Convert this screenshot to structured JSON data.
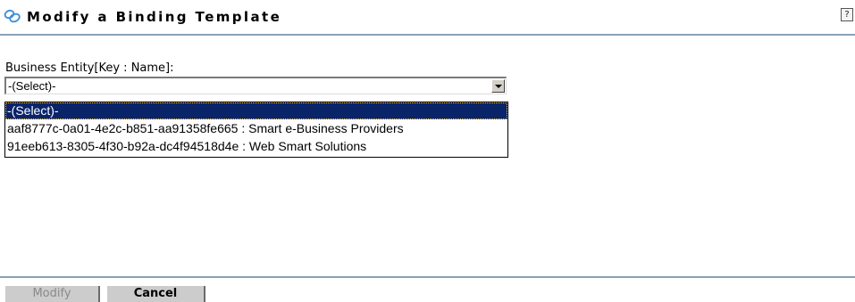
{
  "header": {
    "title": "Modify a Binding Template",
    "icon": "binding-template-icon",
    "help_icon_glyph": "?"
  },
  "form": {
    "business_entity": {
      "label": "Business Entity[Key : Name]:",
      "selected_value": "-(Select)-",
      "options": [
        {
          "label": "-(Select)-",
          "selected": true
        },
        {
          "label": "aaf8777c-0a01-4e2c-b851-aa91358fe665 : Smart e-Business Providers",
          "selected": false
        },
        {
          "label": "91eeb613-8305-4f30-b92a-dc4f94518d4e : Web Smart Solutions",
          "selected": false
        }
      ]
    }
  },
  "footer": {
    "modify_label": "Modify",
    "modify_enabled": false,
    "cancel_label": "Cancel"
  },
  "colors": {
    "rule": "#8aa1b8",
    "selection": "#0a246a",
    "button_bg": "#cccccc",
    "icon_blue": "#3a8fd8"
  }
}
